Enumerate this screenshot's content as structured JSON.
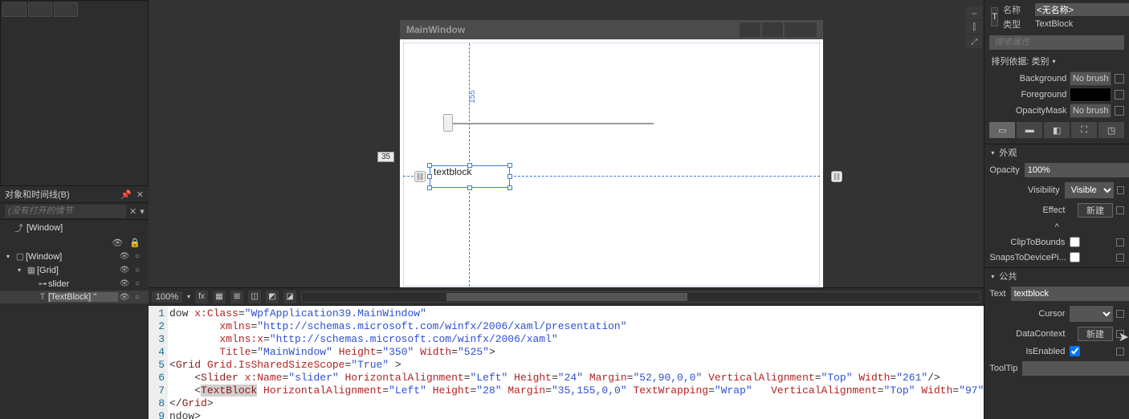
{
  "panels": {
    "objects_timeline_title": "对象和时间线(B)",
    "obj_search_placeholder": "(没有打开的情节",
    "root_item": "[Window]",
    "tree": {
      "window": "[Window]",
      "grid": "[Grid]",
      "slider": "slider",
      "textblock": "[TextBlock] \""
    }
  },
  "designer": {
    "window_title": "MainWindow",
    "margin_label": "35",
    "v_measure": "155",
    "selected_text": "textblock",
    "zoom": "100%"
  },
  "code": {
    "lines": [
      "1",
      "2",
      "3",
      "4",
      "5",
      "6",
      "7",
      "8",
      "9"
    ],
    "l1a": "dow ",
    "l1b": "x:Class",
    "l1c": "\"WpfApplication39.MainWindow\"",
    "l2a": "xmlns",
    "l2b": "\"http://schemas.microsoft.com/winfx/2006/xaml/presentation\"",
    "l3a": "xmlns:x",
    "l3b": "\"http://schemas.microsoft.com/winfx/2006/xaml\"",
    "l4a": "Title",
    "l4b": "\"MainWindow\"",
    "l4c": "Height",
    "l4d": "\"350\"",
    "l4e": "Width",
    "l4f": "\"525\"",
    "l5a": "Grid",
    "l5b": "Grid.IsSharedSizeScope",
    "l5c": "\"True\"",
    "l6a": "Slider",
    "l6b": "x:Name",
    "l6c": "\"slider\"",
    "l6d": "HorizontalAlignment",
    "l6e": "\"Left\"",
    "l6f": "Height",
    "l6g": "\"24\"",
    "l6h": "Margin",
    "l6i": "\"52,90,0,0\"",
    "l6j": "VerticalAlignment",
    "l6k": "\"Top\"",
    "l6l": "Width",
    "l6m": "\"261\"",
    "l7a": "TextBlock",
    "l7b": "HorizontalAlignment",
    "l7c": "\"Left\"",
    "l7d": "Height",
    "l7e": "\"28\"",
    "l7f": "Margin",
    "l7g": "\"35,155,0,0\"",
    "l7h": "TextWrapping",
    "l7i": "\"Wrap\"",
    "l7j": "VerticalAlignment",
    "l7k": "\"Top\"",
    "l7l": "Width",
    "l7m": "\"97\"",
    "l8a": "Grid",
    "l9a": "ndow>"
  },
  "props": {
    "name_lbl": "名称",
    "name_val": "<无名称>",
    "type_lbl": "类型",
    "type_val": "TextBlock",
    "search_placeholder": "搜索属性",
    "sort_label": "排列依据: 类别",
    "brush": {
      "background_lbl": "Background",
      "background_val": "No brush",
      "foreground_lbl": "Foreground",
      "opacitymask_lbl": "OpacityMask",
      "opacitymask_val": "No brush"
    },
    "cat_appearance": "外观",
    "opacity_lbl": "Opacity",
    "opacity_val": "100%",
    "visibility_lbl": "Visibility",
    "visibility_val": "Visible",
    "effect_lbl": "Effect",
    "effect_btn": "新建",
    "clip_lbl": "ClipToBounds",
    "snaps_lbl": "SnapsToDevicePi...",
    "cat_public": "公共",
    "text_lbl": "Text",
    "text_val": "textblock",
    "cursor_lbl": "Cursor",
    "datacontext_lbl": "DataContext",
    "datacontext_btn": "新建",
    "isenabled_lbl": "IsEnabled",
    "tooltip_lbl": "ToolTip"
  }
}
